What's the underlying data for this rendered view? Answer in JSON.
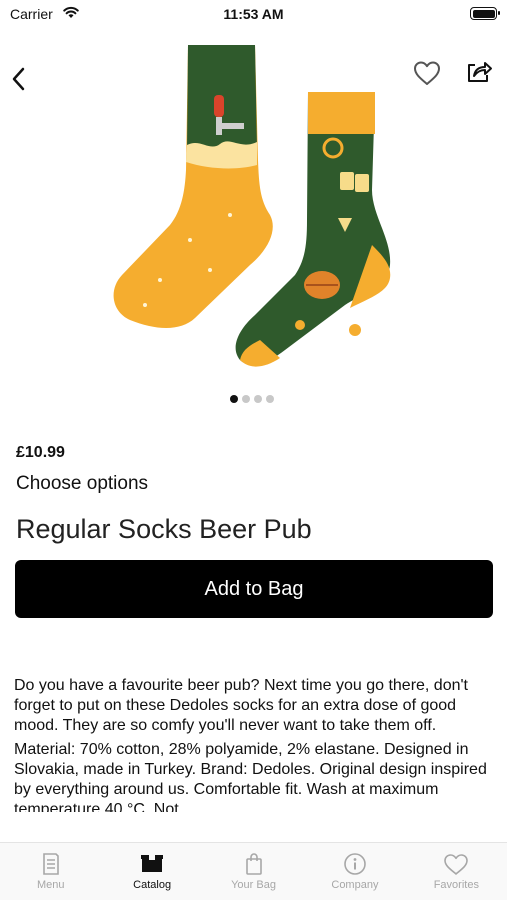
{
  "status_bar": {
    "carrier": "Carrier",
    "time": "11:53 AM"
  },
  "icons": {
    "back": "chevron-left-icon",
    "favorite": "heart-icon",
    "share": "share-icon"
  },
  "product": {
    "image_count": 4,
    "active_image": 1,
    "price": "£10.99",
    "choose_options": "Choose options",
    "title": "Regular Socks Beer Pub",
    "add_to_bag": "Add to Bag",
    "description": "Do you have a favourite beer pub? Next time you go there, don't forget to put on these Dedoles socks for an extra dose of good mood. They are so comfy you'll never want to take them off.",
    "details": "Material: 70% cotton, 28% polyamide, 2% elastane. Designed in Slovakia, made in Turkey. Brand: Dedoles. Original design inspired by everything around us. Comfortable fit. Wash at maximum temperature 40 °C. Not"
  },
  "tabs": [
    {
      "label": "Menu",
      "icon": "menu-book-icon",
      "active": false
    },
    {
      "label": "Catalog",
      "icon": "catalog-box-icon",
      "active": true
    },
    {
      "label": "Your Bag",
      "icon": "bag-icon",
      "active": false
    },
    {
      "label": "Company",
      "icon": "info-icon",
      "active": false
    },
    {
      "label": "Favorites",
      "icon": "heart-icon",
      "active": false
    }
  ],
  "colors": {
    "sock_green": "#2f5a2c",
    "sock_orange": "#f5ad2f",
    "button_bg": "#000000",
    "tab_inactive": "#a7a7a7"
  }
}
